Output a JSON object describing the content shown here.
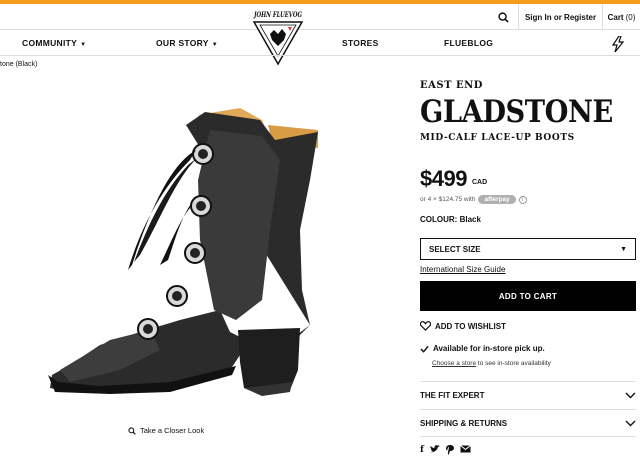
{
  "header": {
    "sign_in": "Sign In or Register",
    "cart": "Cart",
    "cart_count": "(0)",
    "logo_text": "JOHN FLUEVOG"
  },
  "nav": {
    "items": [
      {
        "label": "COMMUNITY",
        "has_dropdown": true
      },
      {
        "label": "OUR STORY",
        "has_dropdown": true
      },
      {
        "label": "STORES",
        "has_dropdown": false
      },
      {
        "label": "FLUEBLOG",
        "has_dropdown": false
      }
    ]
  },
  "breadcrumb": "tone (Black)",
  "gallery": {
    "closer_look": "Take a Closer Look"
  },
  "product": {
    "brand_line": "EAST END",
    "title": "GLADSTONE",
    "subtitle": "MID-CALF LACE-UP BOOTS",
    "price": "$499",
    "currency": "CAD",
    "afterpay_text": "or 4 × $124.75 with",
    "afterpay_badge": "afterpay",
    "colour_label": "COLOUR:",
    "colour_value": "Black",
    "select_size": "SELECT SIZE",
    "size_guide": "International Size Guide",
    "add_to_cart": "ADD TO CART",
    "wishlist": "ADD TO WISHLIST",
    "instore": "Available for in-store pick up.",
    "choose_store_link": "Choose a store",
    "choose_store_rest": "to see in-store availability",
    "fit_expert": "THE FIT EXPERT",
    "shipping": "SHIPPING & RETURNS"
  },
  "colors": {
    "accent_bar": "#f39c1d",
    "button_bg": "#000000"
  }
}
